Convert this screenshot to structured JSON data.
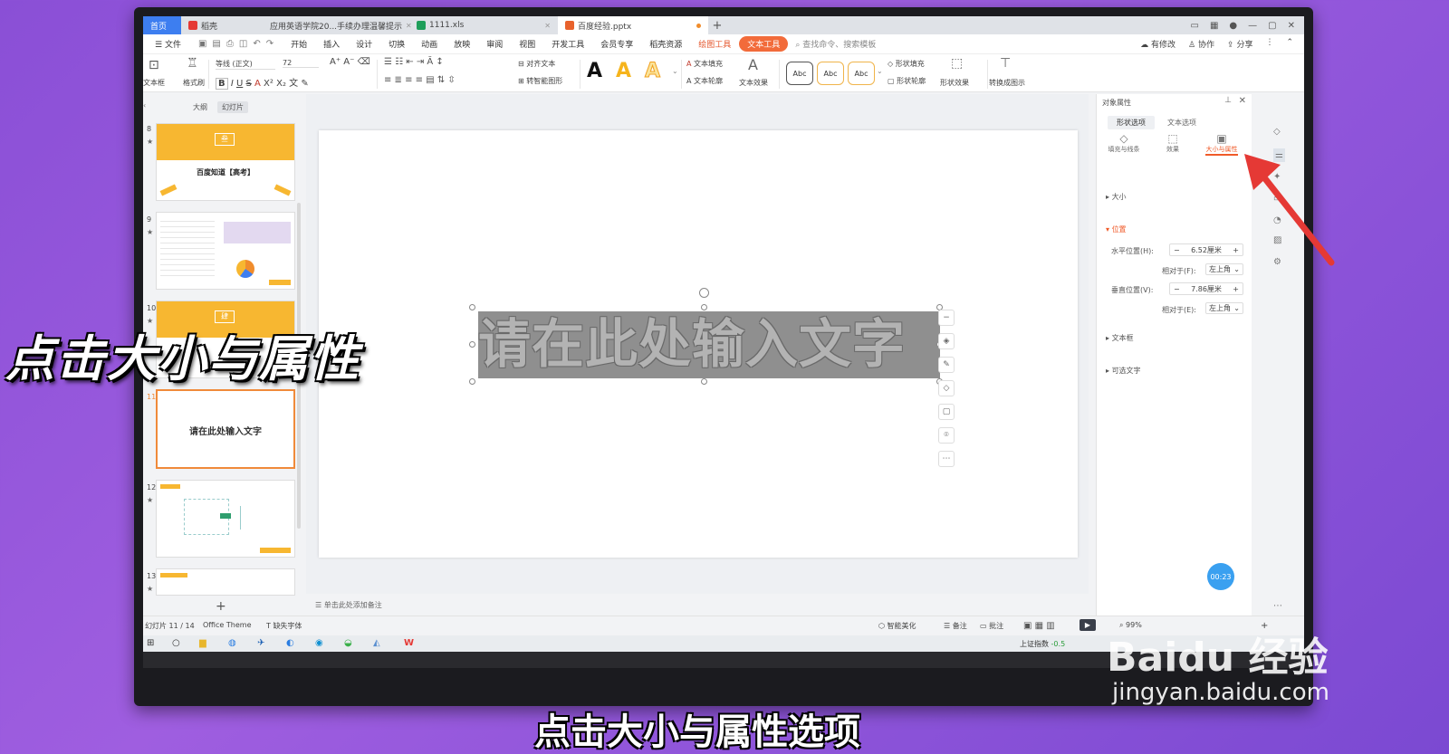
{
  "tabs": [
    {
      "label": "首页",
      "color": "#3d7ef0"
    },
    {
      "label": "稻壳",
      "color": "#e53935"
    },
    {
      "label": "应用英语学院20...手续办理温馨提示",
      "color": "#3d6ee0"
    },
    {
      "label": "1111.xls",
      "color": "#1e9e5a"
    },
    {
      "label": "百度经验.pptx",
      "color": "#e8622c"
    }
  ],
  "menu": {
    "file": "文件",
    "items": [
      "开始",
      "插入",
      "设计",
      "切换",
      "动画",
      "放映",
      "审阅",
      "视图",
      "开发工具",
      "会员专享",
      "稻壳资源"
    ],
    "context_tool": "绘图工具",
    "context_active": "文本工具",
    "search": "查找命令、搜索模板",
    "right": [
      "有修改",
      "协作",
      "分享"
    ]
  },
  "ribbon": {
    "textbox": "文本框",
    "format_brush": "格式刷",
    "font_name": "等线 (正文)",
    "font_size": "72",
    "align_text": "对齐文本",
    "smart_art": "转智能图形",
    "text_fill": "文本填充",
    "text_outline": "文本轮廓",
    "text_effect": "文本效果",
    "style_abc": "Abc",
    "shape_fill": "形状填充",
    "shape_outline": "形状轮廓",
    "shape_effect": "形状效果",
    "convert_image": "转换成图示"
  },
  "left_panel": {
    "tab_outline": "大纲",
    "tab_slides": "幻灯片",
    "slides": [
      {
        "num": "8",
        "title": "百度知道【高考】",
        "tag": "叁"
      },
      {
        "num": "9"
      },
      {
        "num": "10",
        "tag": "肆"
      },
      {
        "num": "11",
        "title": "请在此处输入文字"
      },
      {
        "num": "12"
      },
      {
        "num": "13"
      }
    ]
  },
  "slide": {
    "text": "请在此处输入文字"
  },
  "notes_placeholder": "单击此处添加备注",
  "right_panel": {
    "title": "对象属性",
    "tabs": [
      "形状选项",
      "文本选项"
    ],
    "icons": [
      "填充与线条",
      "效果",
      "大小与属性"
    ],
    "sections": {
      "size": "大小",
      "position": "位置",
      "textbox": "文本框",
      "alt_text": "可选文字"
    },
    "h_pos_label": "水平位置(H):",
    "h_pos_value": "6.52厘米",
    "h_rel_label": "相对于(F):",
    "h_rel_value": "左上角",
    "v_pos_label": "垂直位置(V):",
    "v_pos_value": "7.86厘米",
    "v_rel_label": "相对于(E):",
    "v_rel_value": "左上角",
    "timer": "00:23"
  },
  "status": {
    "slide_count": "幻灯片 11 / 14",
    "theme": "Office Theme",
    "missing_font": "缺失字体",
    "smart_beautify": "智能美化",
    "notes": "备注",
    "comments": "批注",
    "zoom": "99%"
  },
  "taskbar": {
    "stock_label": "上证指数",
    "stock_change": "-0.5"
  },
  "overlay": {
    "caption": "点击大小与属性",
    "subtitle": "点击大小与属性选项",
    "watermark_logo": "Baidu 经验",
    "watermark_url": "jingyan.baidu.com"
  },
  "colors": {
    "accent": "#f05a28",
    "highlight_arrow": "#e53935",
    "thumb_yellow": "#f7b731"
  }
}
